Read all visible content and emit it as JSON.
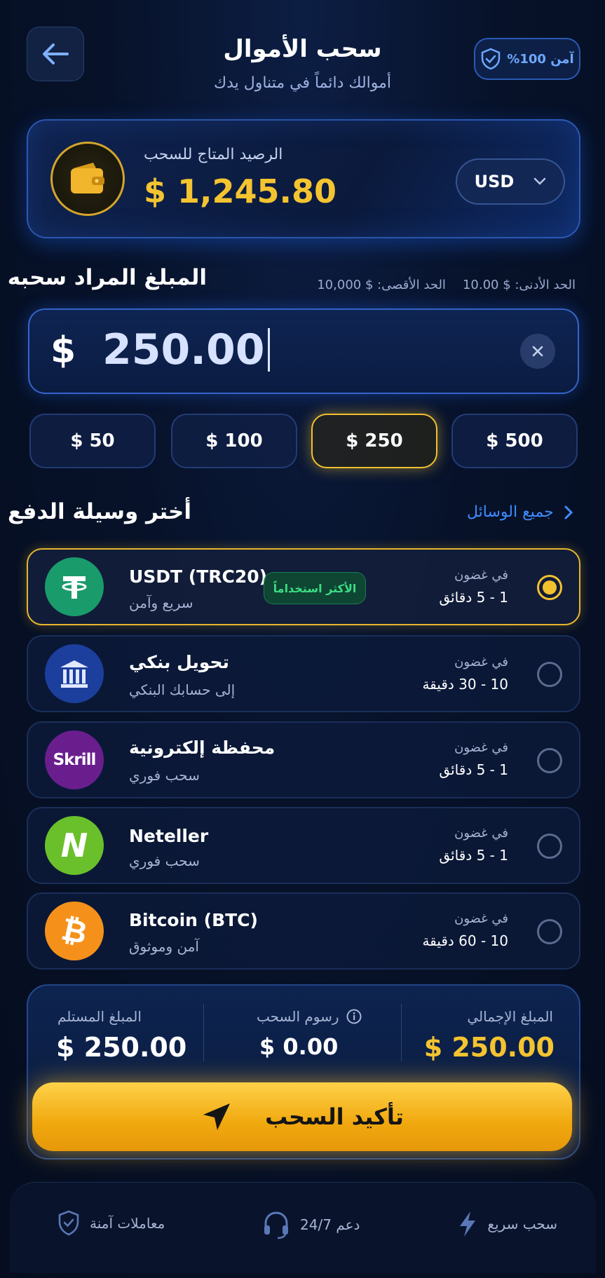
{
  "header": {
    "title": "سحب الأموال",
    "subtitle": "أموالك دائماً في متناول يدك",
    "secure_badge": "آمن 100%"
  },
  "balance": {
    "label": "الرصيد المتاج للسحب",
    "amount": "$ 1,245.80",
    "currency": "USD"
  },
  "amount_section": {
    "heading": "المبلغ المراد سحبه",
    "min_limit": "الحد الأدنى: $ 10.00",
    "max_limit": "الحد الأقصى: $ 10,000",
    "currency_symbol": "$",
    "value": "250.00"
  },
  "quick_amounts": [
    {
      "label": "$ 50",
      "active": false
    },
    {
      "label": "$ 100",
      "active": false
    },
    {
      "label": "$ 250",
      "active": true
    },
    {
      "label": "$ 500",
      "active": false
    }
  ],
  "payment": {
    "heading": "أختر وسيلة الدفع",
    "all_methods": "جميع الوسائل",
    "popular_badge": "الأكثر استخداماً",
    "methods": [
      {
        "name": "USDT (TRC20)",
        "sub": "سريع وآمن",
        "within": "في غضون",
        "time": "1 - 5  دقائق",
        "icon": "tether-icon",
        "selected": true
      },
      {
        "name": "تحويل بنكي",
        "sub": "إلى حسابك البنكي",
        "within": "في غضون",
        "time": "10 - 30  دقيقة",
        "icon": "bank-icon",
        "selected": false
      },
      {
        "name": "محفظة إلكترونية",
        "sub": "سحب فوري",
        "within": "في غضون",
        "time": "1 - 5  دقائق",
        "icon": "skrill-icon",
        "selected": false
      },
      {
        "name": "Neteller",
        "sub": "سحب فوري",
        "within": "في غضون",
        "time": "1 - 5  دقائق",
        "icon": "neteller-icon",
        "selected": false
      },
      {
        "name": "Bitcoin (BTC)",
        "sub": "آمن وموثوق",
        "within": "في غضون",
        "time": "10 - 60  دقيقة",
        "icon": "bitcoin-icon",
        "selected": false
      }
    ]
  },
  "summary": {
    "total_label": "المبلغ الإجمالي",
    "total_value": "$ 250.00",
    "fee_label": "رسوم السحب",
    "fee_value": "$ 0.00",
    "received_label": "المبلغ المستلم",
    "received_value": "$ 250.00",
    "confirm_label": "تأكيد السحب"
  },
  "footer": {
    "fast": "سحب سريع",
    "support": "دعم 24/7",
    "secure": "معاملات آمنة"
  },
  "colors": {
    "accent_gold": "#f4c430",
    "accent_blue": "#3f8cff",
    "success_green": "#3ddc84",
    "background": "#07122a"
  }
}
